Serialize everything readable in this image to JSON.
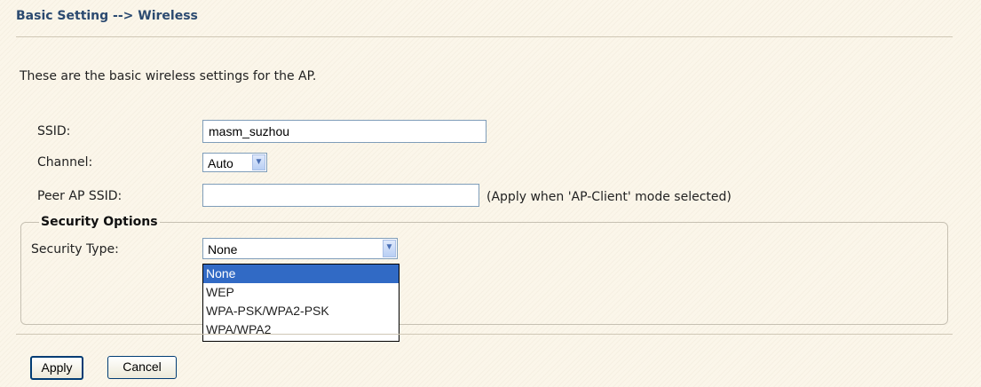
{
  "header": {
    "title": "Basic Setting --> Wireless"
  },
  "intro": "These are the basic wireless settings for the AP.",
  "form": {
    "ssid_label": "SSID:",
    "ssid_value": "masm_suzhou",
    "channel_label": "Channel:",
    "channel_value": "Auto",
    "peer_label": "Peer AP SSID:",
    "peer_value": "",
    "peer_hint": "(Apply when 'AP-Client' mode selected)"
  },
  "security": {
    "legend": "Security Options",
    "type_label": "Security Type:",
    "type_value": "None",
    "options": [
      "None",
      "WEP",
      "WPA-PSK/WPA2-PSK",
      "WPA/WPA2"
    ],
    "selected_index": 0
  },
  "buttons": {
    "apply": "Apply",
    "cancel": "Cancel"
  },
  "icons": {
    "dropdown_arrow": "chevron-down-icon"
  },
  "colors": {
    "title": "#2b4a70",
    "selection": "#316ac5",
    "background": "#fbf6ea"
  }
}
